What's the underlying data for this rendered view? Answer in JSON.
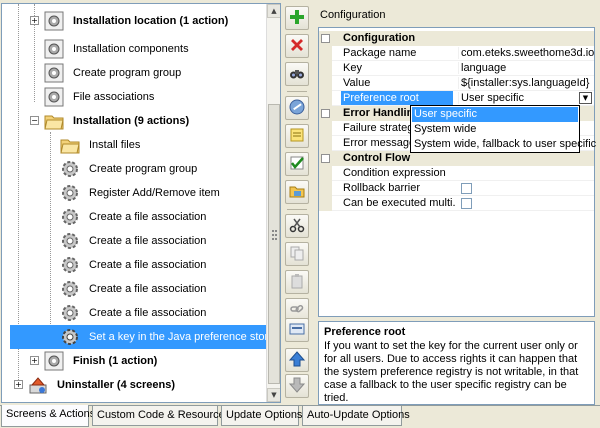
{
  "tree": {
    "items": [
      {
        "label": "Installation location",
        "suffix": "(1 action)",
        "bold": true
      },
      {
        "label": "Installation components"
      },
      {
        "label": "Create program group"
      },
      {
        "label": "File associations"
      },
      {
        "label": "Installation",
        "suffix": "(9 actions)",
        "bold": true
      },
      {
        "label": "Install files"
      },
      {
        "label": "Create program group"
      },
      {
        "label": "Register Add/Remove item"
      },
      {
        "label": "Create a file association"
      },
      {
        "label": "Create a file association"
      },
      {
        "label": "Create a file association"
      },
      {
        "label": "Create a file association"
      },
      {
        "label": "Create a file association"
      },
      {
        "label": "Set a key in the Java preference store",
        "selected": true
      },
      {
        "label": "Finish",
        "suffix": "(1 action)",
        "bold": true
      },
      {
        "label": "Uninstaller",
        "suffix": "(4 screens)",
        "bold": true
      }
    ]
  },
  "toolbar": {
    "buttons": [
      "add-icon",
      "delete-icon",
      "binoculars-icon",
      "edit-icon",
      "note-icon",
      "check-icon",
      "folder-icon",
      "cut-icon",
      "copy-icon",
      "paste-icon",
      "link-icon",
      "form-icon",
      "up-arrow-icon",
      "down-arrow-icon"
    ]
  },
  "config": {
    "title": "Configuration",
    "categories": {
      "configuration": "Configuration",
      "error_handling": "Error Handling",
      "control_flow": "Control Flow"
    },
    "rows": {
      "package_name": {
        "name": "Package name",
        "value": "com.eteks.sweethome3d.io"
      },
      "key": {
        "name": "Key",
        "value": "language"
      },
      "value": {
        "name": "Value",
        "value": "${installer:sys.languageId}"
      },
      "preference_root": {
        "name": "Preference root",
        "value": "User specific"
      },
      "failure_strategy": {
        "name": "Failure strategy"
      },
      "error_message": {
        "name": "Error message"
      },
      "condition_expression": {
        "name": "Condition expression"
      },
      "rollback_barrier": {
        "name": "Rollback barrier"
      },
      "can_be_executed": {
        "name": "Can be executed multi..."
      }
    },
    "dropdown_options": [
      "User specific",
      "System wide",
      "System wide, fallback to user specific"
    ]
  },
  "help": {
    "title": "Preference root",
    "text": "If you want to set the key for the current user only or for all users. Due to access rights it can happen that the system preference registry is not writable, in that case a fallback to the user specific registry can be tried."
  },
  "tabs": [
    "Screens & Actions",
    "Custom Code & Resources",
    "Update Options",
    "Auto-Update Options"
  ],
  "colors": {
    "selection": "#3399ff",
    "panel_bg": "#ece9d8"
  }
}
